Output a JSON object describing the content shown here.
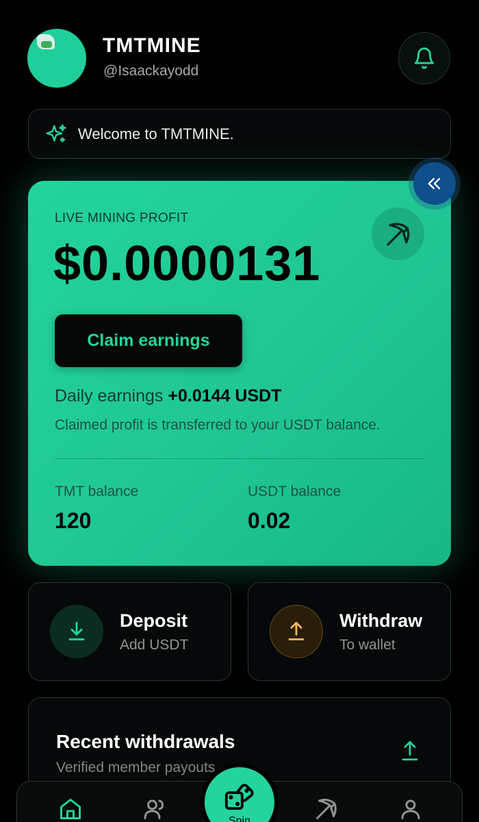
{
  "header": {
    "brand": "TMTMINE",
    "handle": "@Isaackayodd",
    "avatar_icon": "avatar-image",
    "notification_icon": "bell-icon"
  },
  "welcome": {
    "text": "Welcome to TMTMINE.",
    "icon": "sparkle-icon"
  },
  "mining": {
    "label": "LIVE MINING PROFIT",
    "profit": "$0.0000131",
    "claim_label": "Claim earnings",
    "daily_prefix": "Daily earnings",
    "daily_value": "+0.0144 USDT",
    "claim_note": "Claimed profit is transferred to your USDT balance.",
    "tmt_label": "TMT balance",
    "tmt_value": "120",
    "usdt_label": "USDT balance",
    "usdt_value": "0.02"
  },
  "actions": {
    "deposit_title": "Deposit",
    "deposit_sub": "Add USDT",
    "withdraw_title": "Withdraw",
    "withdraw_sub": "To wallet"
  },
  "recent": {
    "title": "Recent withdrawals",
    "subtitle": "Verified member payouts"
  },
  "nav": {
    "spin_label": "Spin",
    "items": [
      "home-icon",
      "users-icon",
      "dice-icon",
      "pickaxe-icon",
      "user-icon"
    ]
  },
  "colors": {
    "accent": "#23d49c",
    "withdraw_accent": "#f0b85a",
    "background": "#000000",
    "collapse_button": "#0f4f8c"
  }
}
